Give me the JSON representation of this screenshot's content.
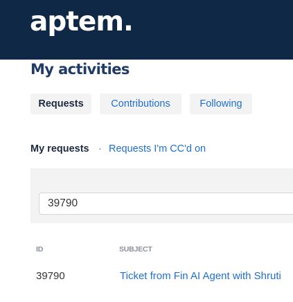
{
  "header": {
    "logo_text": "aptem."
  },
  "page": {
    "title": "My activities"
  },
  "tabs": [
    {
      "label": "Requests",
      "active": true
    },
    {
      "label": "Contributions",
      "active": false
    },
    {
      "label": "Following",
      "active": false
    }
  ],
  "subnav": {
    "current": "My requests",
    "separator": "·",
    "link": "Requests I'm CC'd on"
  },
  "search": {
    "value": "39790"
  },
  "table": {
    "columns": [
      "ID",
      "SUBJECT"
    ],
    "rows": [
      {
        "id": "39790",
        "subject": "Ticket from Fin AI Agent with Shruti"
      }
    ]
  },
  "colors": {
    "header_bg": "#0f2846",
    "link": "#1f6fd1",
    "title": "#1f3b66",
    "tab_bg": "#f3f3f3"
  }
}
